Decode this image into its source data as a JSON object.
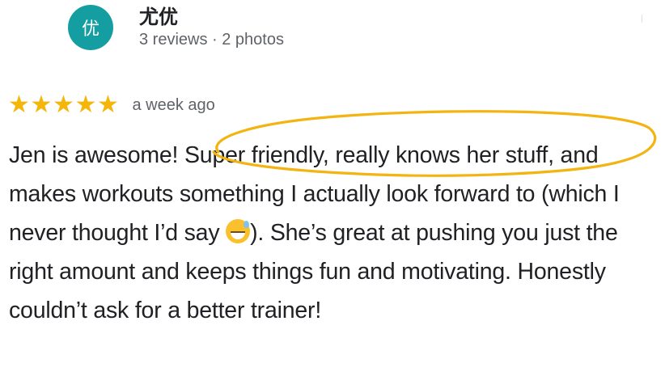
{
  "reviewer": {
    "avatar_initial": "优",
    "name": "尤优",
    "meta": "3 reviews · 2 photos"
  },
  "review": {
    "rating": 5,
    "stars": [
      "★",
      "★",
      "★",
      "★",
      "★"
    ],
    "date": "a week ago",
    "text_before_emoji": "Jen is awesome! Super friendly, really knows her stuff, and makes workouts something I actually look forward to (which I never thought I’d say ",
    "emoji": "grinning-face-with-sweat",
    "text_after_emoji": "). She’s great at pushing you just the right amount and keeps things fun and motivating. Honestly couldn’t ask for a better trainer!"
  },
  "colors": {
    "avatar_bg": "#159ea2",
    "star": "#f5b60a",
    "highlight_ellipse": "#f3b411",
    "muted_text": "#5f6368"
  }
}
